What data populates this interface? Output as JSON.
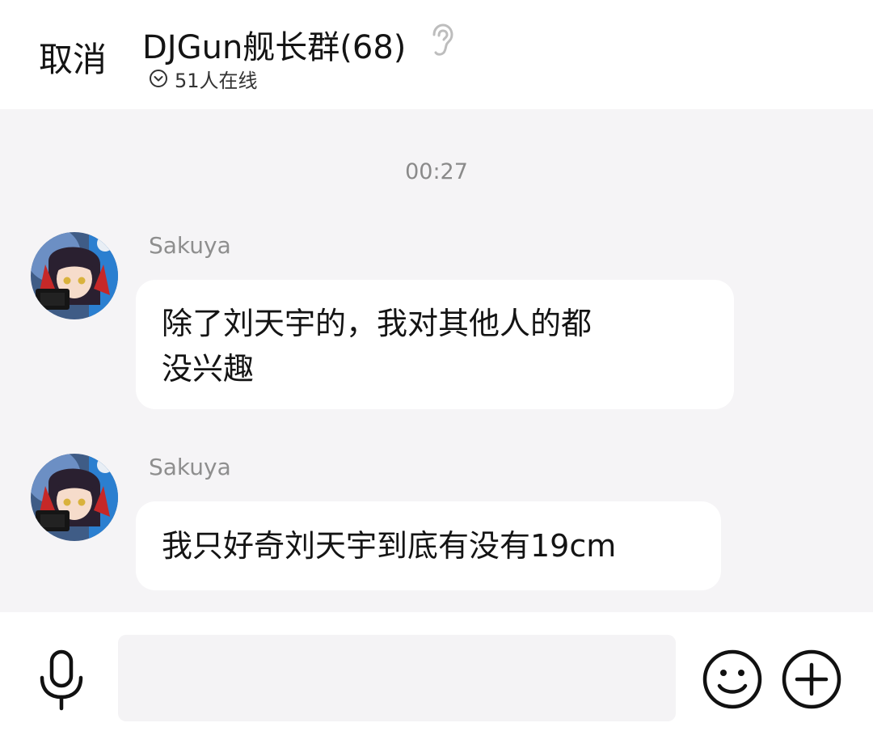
{
  "header": {
    "cancel_label": "取消",
    "group_title": "DJGun舰长群(68)",
    "online_status": "51人在线"
  },
  "chat": {
    "timestamp": "00:27",
    "messages": [
      {
        "sender": "Sakuya",
        "lines": [
          "除了刘天宇的，我对其他人的都",
          "没兴趣"
        ]
      },
      {
        "sender": "Sakuya",
        "lines": [
          "我只好奇刘天宇到底有没有19cm"
        ]
      }
    ]
  },
  "input_bar": {
    "text_value": ""
  },
  "icons": {
    "ear": "ear-icon",
    "online_chevron": "chevron-down-circle-icon",
    "mic": "microphone-icon",
    "emoji": "emoji-smile-icon",
    "plus": "plus-circle-icon"
  },
  "colors": {
    "chat_background": "#f5f4f6",
    "bubble": "#ffffff",
    "secondary_text": "#8e8e8e"
  }
}
